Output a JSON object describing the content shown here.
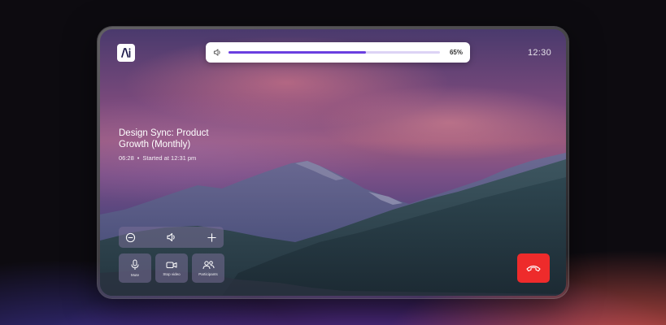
{
  "app": {
    "logo_text": "Ai",
    "clock": "12:30"
  },
  "volume_popup": {
    "icon": "speaker-icon",
    "level_percent": 65,
    "label": "65%"
  },
  "meeting": {
    "title": "Design Sync: Product Growth (Monthly)",
    "elapsed": "06:28",
    "separator": "•",
    "started": "Started at 12:31 pm"
  },
  "volume_controls": {
    "decrease_icon": "minus-circle-icon",
    "speaker_icon": "speaker-icon",
    "increase_icon": "plus-icon"
  },
  "controls": [
    {
      "icon": "microphone-icon",
      "label": "Mute"
    },
    {
      "icon": "video-camera-icon",
      "label": "Stop video"
    },
    {
      "icon": "participants-icon",
      "label": "Participants"
    }
  ],
  "end_call": {
    "icon": "hang-up-icon"
  },
  "colors": {
    "accent": "#6b3fe0",
    "end_call": "#ee2b2b"
  }
}
